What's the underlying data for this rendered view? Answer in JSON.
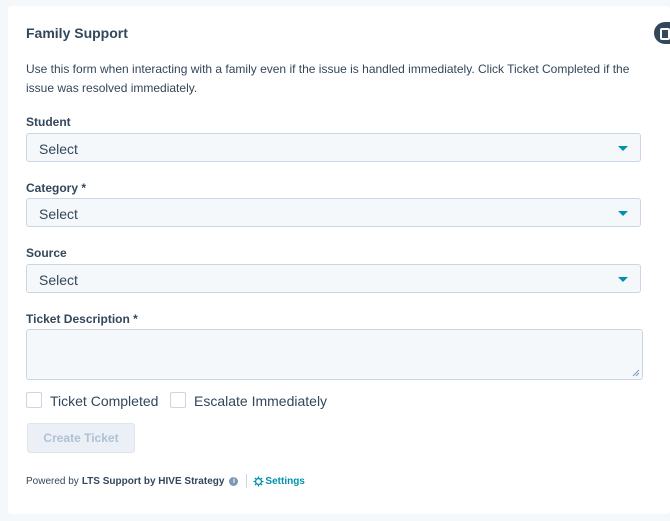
{
  "form": {
    "title": "Family Support",
    "description": "Use this form when interacting with a family even if the issue is handled immediately. Click Ticket Completed if the issue was resolved immediately.",
    "student": {
      "label": "Student",
      "value": "Select"
    },
    "category": {
      "label": "Category *",
      "value": "Select"
    },
    "source": {
      "label": "Source",
      "value": "Select"
    },
    "ticket_description": {
      "label": "Ticket Description *",
      "value": ""
    },
    "checkboxes": [
      {
        "label": "Ticket Completed",
        "checked": false
      },
      {
        "label": "Escalate Immediately",
        "checked": false
      }
    ],
    "submit_label": "Create Ticket"
  },
  "footer": {
    "powered_by": "Powered by",
    "brand": "LTS Support by HIVE Strategy",
    "settings_label": "Settings"
  },
  "colors": {
    "accent": "#0091ae",
    "text": "#33475b",
    "field_bg": "#f5f8fa",
    "border": "#cbd6e2",
    "disabled_text": "#b0c1d4"
  }
}
